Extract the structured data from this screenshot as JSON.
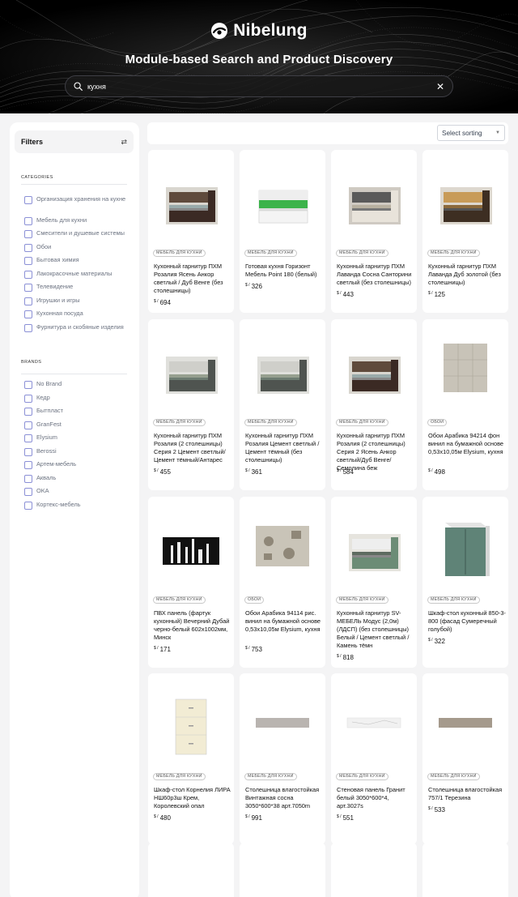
{
  "hero": {
    "brand": "Nibelung",
    "title": "Module-based Search and Product Discovery",
    "search_value": "кухня"
  },
  "filters": {
    "title": "Filters",
    "categories_title": "CATEGORIES",
    "categories": [
      "Организация хранения на кухне",
      "Мебель для кухни",
      "Смесители и душевые системы",
      "Обои",
      "Бытовая химия",
      "Лакокрасочные материалы",
      "Телевидение",
      "Игрушки и игры",
      "Кухонная посуда",
      "Фурнитура и скобяные изделия"
    ],
    "brands_title": "BRANDS",
    "brands": [
      "No Brand",
      "Кедр",
      "Бытпласт",
      "GranFest",
      "Elysium",
      "Berossi",
      "Артем-мебель",
      "Акваль",
      "OKA",
      "Кортекс-мебель"
    ]
  },
  "sorting": {
    "label": "Select sorting"
  },
  "currency": "$",
  "products": [
    {
      "category": "МЕБЕЛЬ ДЛЯ КУХНИ",
      "name": "Кухонный гарнитур ПХМ Розалия Ясень Анкор светлый / Дуб Венге (без столешницы)",
      "price": "694",
      "img": "kitchen-dark"
    },
    {
      "category": "МЕБЕЛЬ ДЛЯ КУХНИ",
      "name": "Готовая кухня Горизонт Мебель Point 180 (белый)",
      "price": "326",
      "img": "kitchen-white"
    },
    {
      "category": "МЕБЕЛЬ ДЛЯ КУХНИ",
      "name": "Кухонный гарнитур ПХМ Лаванда Сосна Санторини светлый (без столешницы)",
      "price": "443",
      "img": "kitchen-light"
    },
    {
      "category": "МЕБЕЛЬ ДЛЯ КУХНИ",
      "name": "Кухонный гарнитур ПХМ Лаванда Дуб золотой (без столешницы)",
      "price": "125",
      "img": "kitchen-wood"
    },
    {
      "category": "МЕБЕЛЬ ДЛЯ КУХНИ",
      "name": "Кухонный гарнитур ПХМ Розалия (2 столешницы) Серия 2 Цемент светлый/ Цемент тёмный/Антарес",
      "price": "455",
      "img": "kitchen-grey"
    },
    {
      "category": "МЕБЕЛЬ ДЛЯ КУХНИ",
      "name": "Кухонный гарнитур ПХМ Розалия Цемент светлый / Цемент тёмный (без столешницы)",
      "price": "361",
      "img": "kitchen-grey"
    },
    {
      "category": "МЕБЕЛЬ ДЛЯ КУХНИ",
      "name": "Кухонный гарнитур ПХМ Розалия (2 столешницы) Серия 2 Ясень Анкор светлый/Дуб Венге/ Семолина беж",
      "price": "584",
      "img": "kitchen-dark"
    },
    {
      "category": "ОБОИ",
      "name": "Обои Арабика 94214 фон винил на бумажной основе 0,53х10,05м Elysium, кухня",
      "price": "498",
      "img": "wallpaper-tile"
    },
    {
      "category": "МЕБЕЛЬ ДЛЯ КУХНИ",
      "name": "ПВХ панель (фартук кухонный) Вечерний Дубай черно-белый 602х1002мм, Минск",
      "price": "171",
      "img": "panel-city"
    },
    {
      "category": "ОБОИ",
      "name": "Обои Арабика 94114 рис. винил на бумажной основе 0,53х10,05м Elysium, кухня",
      "price": "753",
      "img": "wallpaper-pattern"
    },
    {
      "category": "МЕБЕЛЬ ДЛЯ КУХНИ",
      "name": "Кухонный гарнитур SV-МЕБЕЛЬ Модус (2,0м) (ЛДСП) (без столешницы) Белый / Цемент светлый / Камень тёмн",
      "price": "818",
      "img": "kitchen-green"
    },
    {
      "category": "МЕБЕЛЬ ДЛЯ КУХНИ",
      "name": "Шкаф-стол кухонный 850-3-800 (фасад Сумеречный голубой)",
      "price": "322",
      "img": "cabinet-teal"
    },
    {
      "category": "МЕБЕЛЬ ДЛЯ КУХНИ",
      "name": "Шкаф-стол Корнелия ЛИРА НШ60р3ш Крем, Королевский опал",
      "price": "480",
      "img": "cabinet-cream"
    },
    {
      "category": "МЕБЕЛЬ ДЛЯ КУХНИ",
      "name": "Столешница влагостойкая Винтажная сосна 3050*600*38 арт.7050m",
      "price": "991",
      "img": "counter-grey"
    },
    {
      "category": "МЕБЕЛЬ ДЛЯ КУХНИ",
      "name": "Стеновая панель Гранит белый 3050*600*4, арт.3027s",
      "price": "551",
      "img": "counter-marble"
    },
    {
      "category": "МЕБЕЛЬ ДЛЯ КУХНИ",
      "name": "Столешница влагостойкая 757/1 Терезина",
      "price": "533",
      "img": "counter-beige"
    },
    {
      "category": "",
      "name": "",
      "price": "",
      "img": "counter-wood"
    },
    {
      "category": "",
      "name": "",
      "price": "",
      "img": "counter-wood"
    },
    {
      "category": "",
      "name": "",
      "price": "",
      "img": "counter-wood-angle"
    },
    {
      "category": "",
      "name": "",
      "price": "",
      "img": "counter-beige-angle"
    }
  ]
}
